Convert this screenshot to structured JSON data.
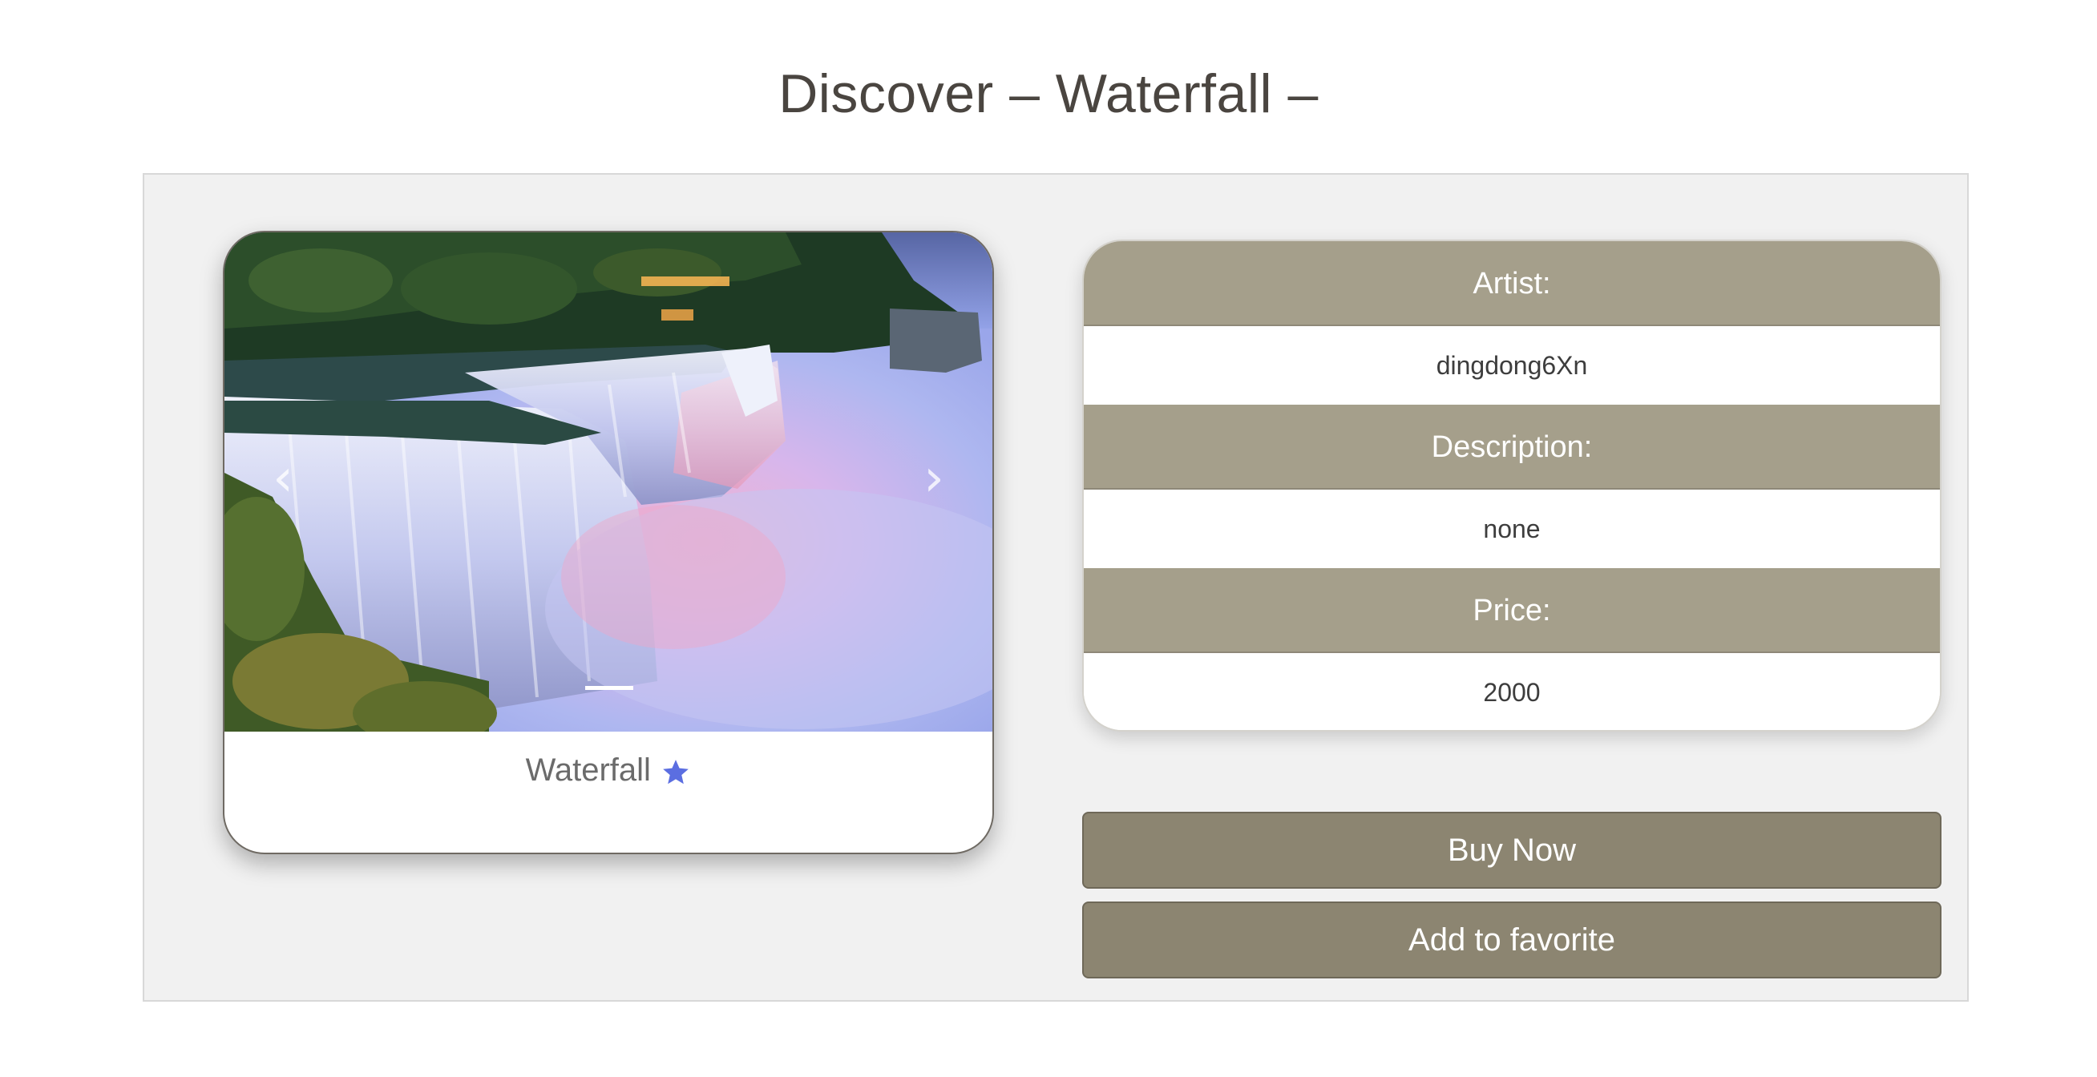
{
  "page": {
    "title": "Discover – Waterfall –"
  },
  "carousel": {
    "prev_icon": "chevron-left-icon",
    "next_icon": "chevron-right-icon",
    "slides_visible": 1
  },
  "card": {
    "title": "Waterfall",
    "favorite_icon": "star-icon",
    "favorite_color": "#5b6ee1"
  },
  "info": {
    "artist_label": "Artist:",
    "artist_value": "dingdong6Xn",
    "description_label": "Description:",
    "description_value": "none",
    "price_label": "Price:",
    "price_value": "2000"
  },
  "actions": {
    "buy_label": "Buy Now",
    "favorite_label": "Add to favorite"
  },
  "colors": {
    "header_bg": "#a59f8b",
    "button_bg": "#8c8571",
    "panel_bg": "#f1f1f1"
  }
}
